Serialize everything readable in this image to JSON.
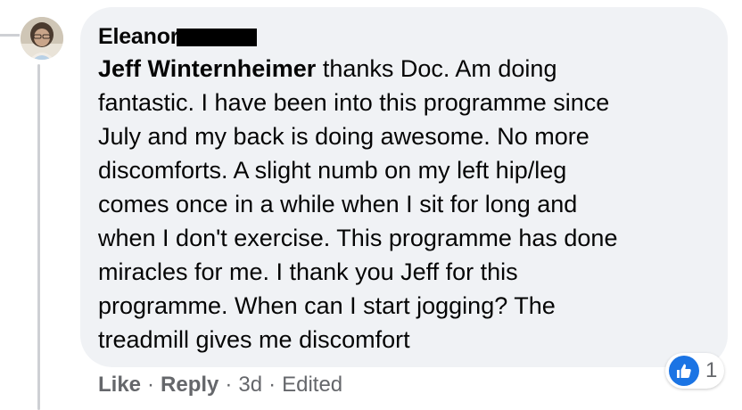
{
  "comment": {
    "author_name": "Eleanor",
    "author_name_redacted": true,
    "mention": "Jeff Winternheimer",
    "text_lines": [
      " thanks Doc. Am doing",
      "fantastic. I have been into this programme since",
      "July and my back is doing awesome. No more",
      "discomforts. A slight numb on my left hip/leg",
      "comes once in a while when I sit for long and",
      "when I don't exercise. This programme has done",
      "miracles for me. I thank you Jeff for this",
      "programme. When can I start jogging? The",
      "treadmill gives me discomfort"
    ]
  },
  "reactions": {
    "icon": "thumbs-up-icon",
    "count": "1",
    "color": "#1b74e4"
  },
  "actions": {
    "like_label": "Like",
    "reply_label": "Reply",
    "separator": "·",
    "timestamp": "3d",
    "edited_label": "Edited"
  },
  "colors": {
    "bubble_bg": "#f0f2f5",
    "secondary_text": "#65676b",
    "thread_line": "#ced0d4"
  }
}
